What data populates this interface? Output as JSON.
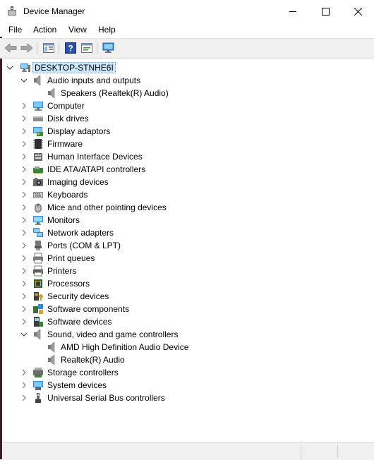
{
  "window": {
    "title": "Device Manager"
  },
  "menu": [
    "File",
    "Action",
    "View",
    "Help"
  ],
  "tree": {
    "root": "DESKTOP-STNHE6I",
    "categories": [
      {
        "label": "Audio inputs and outputs",
        "icon": "speaker-icon",
        "expanded": true,
        "children": [
          "Speakers (Realtek(R) Audio)"
        ]
      },
      {
        "label": "Computer",
        "icon": "computer-icon"
      },
      {
        "label": "Disk drives",
        "icon": "disk-drive-icon"
      },
      {
        "label": "Display adaptors",
        "icon": "display-adapter-icon"
      },
      {
        "label": "Firmware",
        "icon": "firmware-icon"
      },
      {
        "label": "Human Interface Devices",
        "icon": "hid-icon"
      },
      {
        "label": "IDE ATA/ATAPI controllers",
        "icon": "ide-controller-icon"
      },
      {
        "label": "Imaging devices",
        "icon": "camera-icon"
      },
      {
        "label": "Keyboards",
        "icon": "keyboard-icon"
      },
      {
        "label": "Mice and other pointing devices",
        "icon": "mouse-icon"
      },
      {
        "label": "Monitors",
        "icon": "monitor-icon"
      },
      {
        "label": "Network adapters",
        "icon": "network-adapter-icon"
      },
      {
        "label": "Ports (COM & LPT)",
        "icon": "port-icon"
      },
      {
        "label": "Print queues",
        "icon": "print-queue-icon"
      },
      {
        "label": "Printers",
        "icon": "printer-icon"
      },
      {
        "label": "Processors",
        "icon": "processor-icon"
      },
      {
        "label": "Security devices",
        "icon": "security-device-icon"
      },
      {
        "label": "Software components",
        "icon": "software-component-icon"
      },
      {
        "label": "Software devices",
        "icon": "software-device-icon"
      },
      {
        "label": "Sound, video and game controllers",
        "icon": "speaker-icon",
        "expanded": true,
        "children": [
          "AMD High Definition Audio Device",
          "Realtek(R) Audio"
        ]
      },
      {
        "label": "Storage controllers",
        "icon": "storage-controller-icon"
      },
      {
        "label": "System devices",
        "icon": "system-device-icon"
      },
      {
        "label": "Universal Serial Bus controllers",
        "icon": "usb-icon"
      }
    ]
  },
  "colors": {
    "selection": "#cce8ff",
    "toolbar": "#f0f0f0",
    "accent": "#1e7ad6"
  }
}
